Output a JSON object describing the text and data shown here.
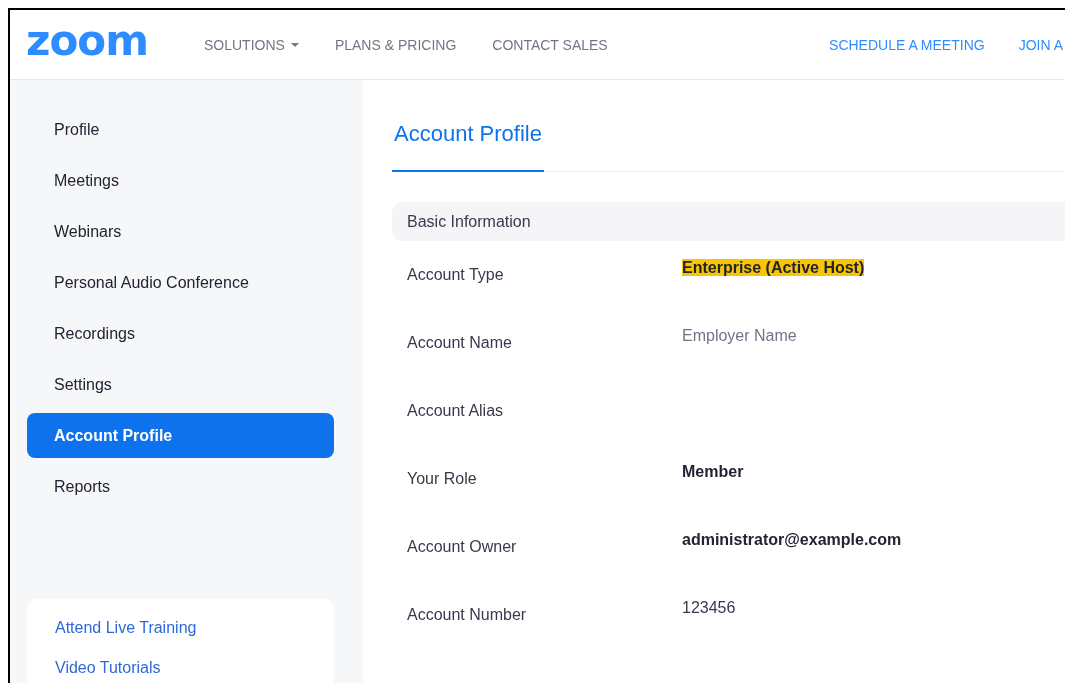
{
  "header": {
    "logo": "zoom",
    "nav": [
      {
        "label": "SOLUTIONS",
        "dropdown": true
      },
      {
        "label": "PLANS & PRICING",
        "dropdown": false
      },
      {
        "label": "CONTACT SALES",
        "dropdown": false
      }
    ],
    "actions": [
      "SCHEDULE A MEETING",
      "JOIN A"
    ]
  },
  "sidebar": {
    "items": [
      {
        "label": "Profile",
        "selected": false
      },
      {
        "label": "Meetings",
        "selected": false
      },
      {
        "label": "Webinars",
        "selected": false
      },
      {
        "label": "Personal Audio Conference",
        "selected": false
      },
      {
        "label": "Recordings",
        "selected": false
      },
      {
        "label": "Settings",
        "selected": false
      },
      {
        "label": "Account Profile",
        "selected": true
      },
      {
        "label": "Reports",
        "selected": false
      }
    ],
    "links": [
      "Attend Live Training",
      "Video Tutorials"
    ]
  },
  "content": {
    "title": "Account Profile",
    "section": "Basic Information",
    "fields": [
      {
        "label": "Account Type",
        "value": "Enterprise (Active Host)",
        "kind": "highlight"
      },
      {
        "label": "Account Name",
        "value": "Employer Name",
        "kind": "muted"
      },
      {
        "label": "Account Alias"
      },
      {
        "label": "Your Role",
        "value": "Member",
        "kind": "bold"
      },
      {
        "label": "Account Owner",
        "value": "administrator@example.com",
        "kind": "bold"
      },
      {
        "label": "Account Number",
        "value": "123456",
        "kind": "plain"
      }
    ]
  }
}
